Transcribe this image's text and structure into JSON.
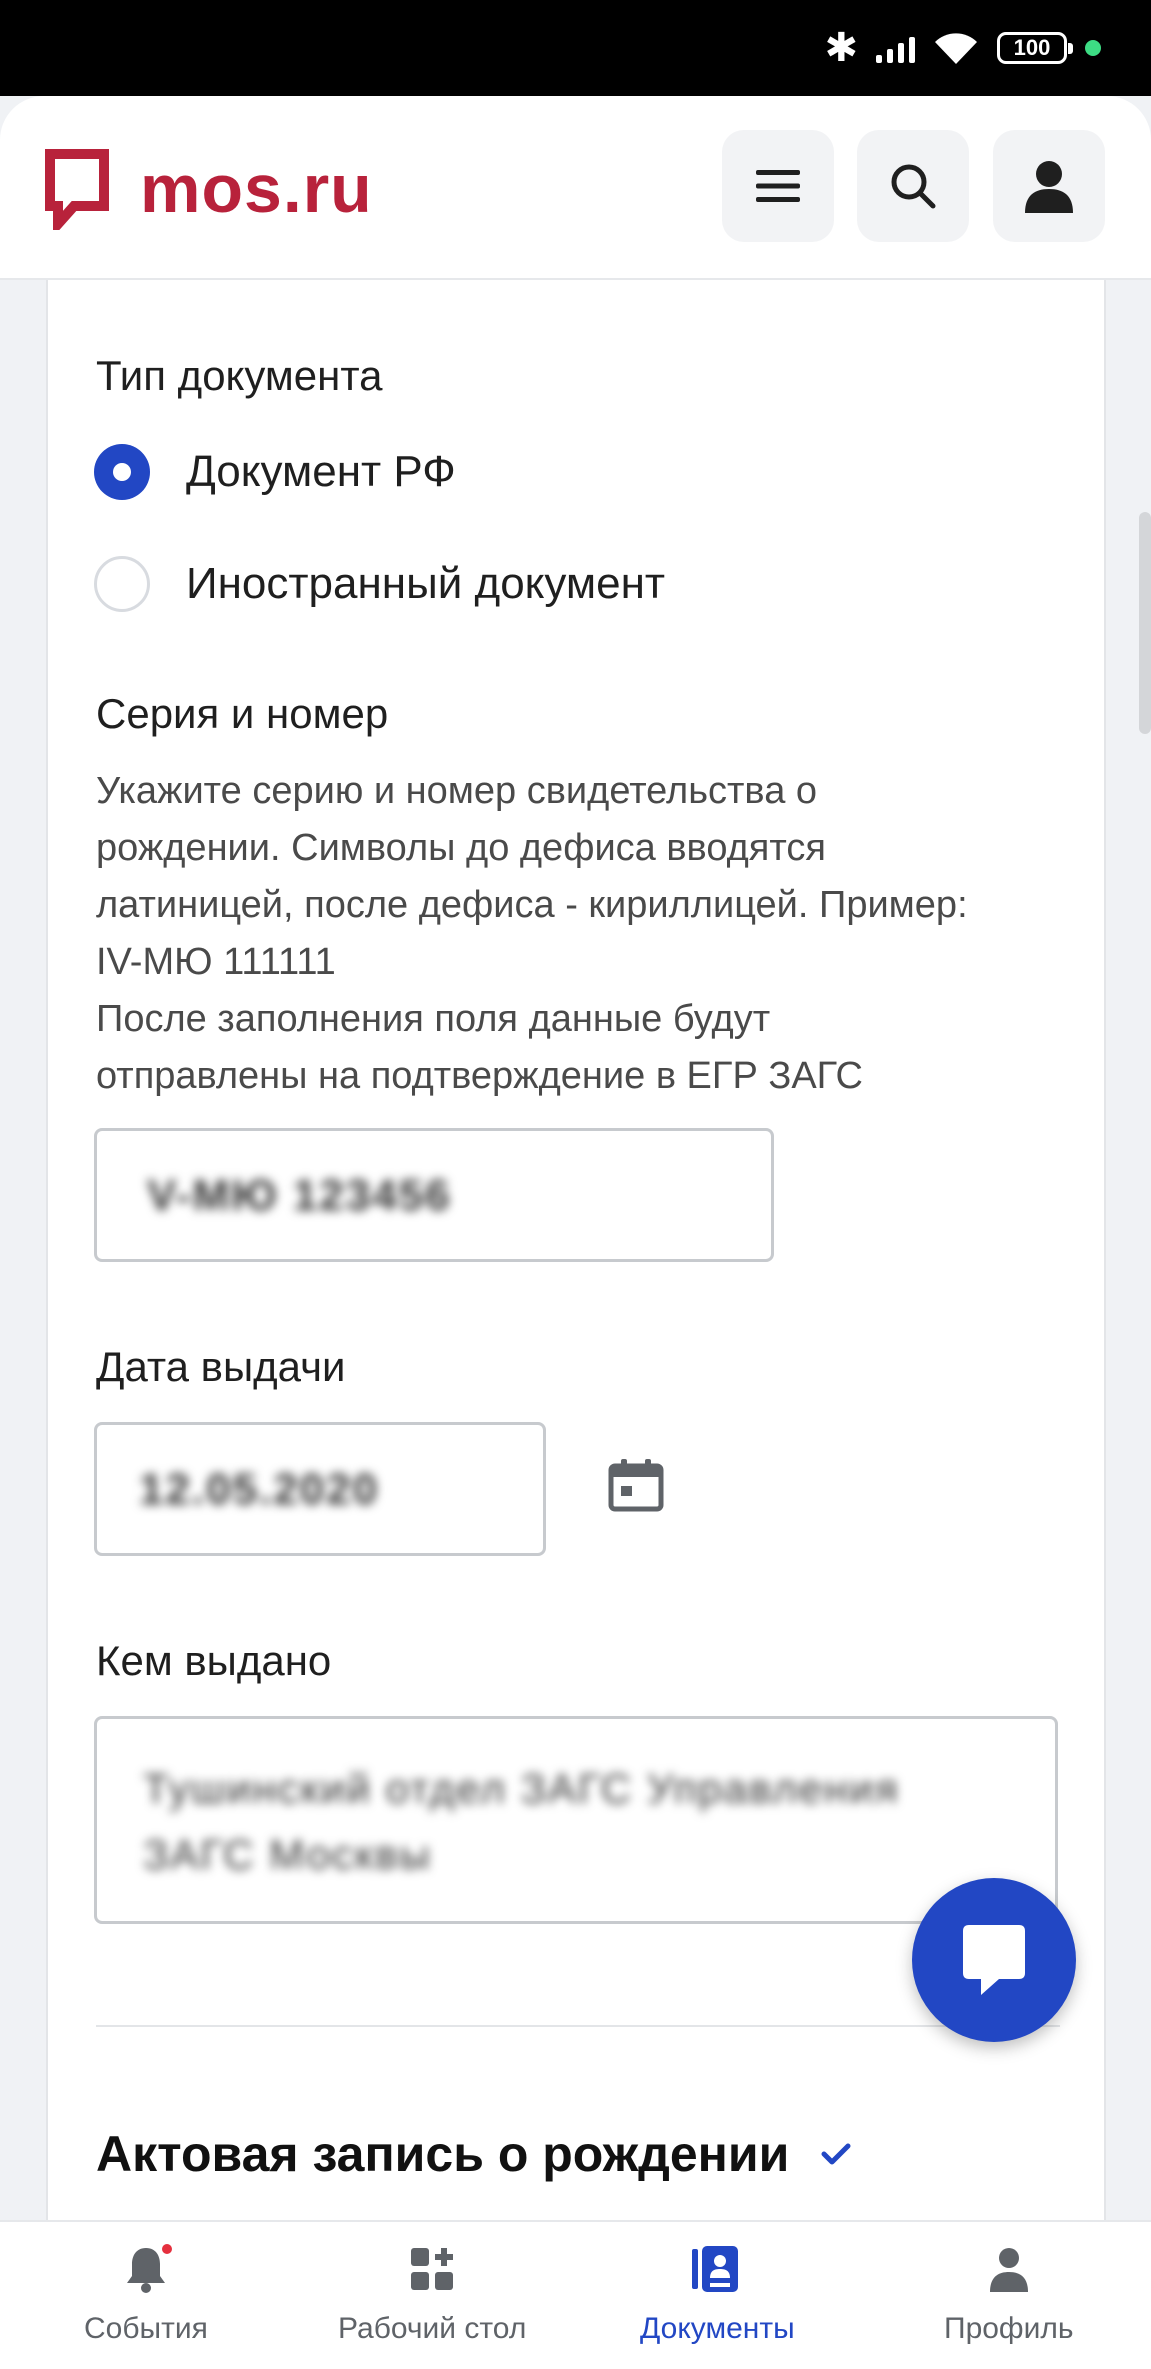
{
  "status_bar": {
    "battery": "100"
  },
  "header": {
    "logo_text": "mos.ru",
    "brand_color": "#b8223b",
    "menu_icon": "menu-icon",
    "search_icon": "search-icon",
    "profile_icon": "user-icon"
  },
  "form": {
    "doc_type": {
      "label": "Тип документа",
      "options": [
        "Документ РФ",
        "Иностранный документ"
      ],
      "selected": "Документ РФ"
    },
    "series_number": {
      "label": "Серия и номер",
      "hint_lines": [
        "Укажите серию и номер свидетельства о",
        "рождении. Символы до дефиса вводятся",
        "латиницей, после дефиса - кириллицей. Пример:",
        "IV-МЮ 111111",
        "После заполнения поля данные будут",
        "отправлены на подтверждение в ЕГР ЗАГС"
      ],
      "value_blurred": "V-МЮ 123456"
    },
    "issue_date": {
      "label": "Дата выдачи",
      "value_blurred": "12.05.2020",
      "calendar_icon": "calendar-icon"
    },
    "issued_by": {
      "label": "Кем выдано",
      "value_blurred_line1": "Тушинский отдел ЗАГС Управления",
      "value_blurred_line2": "ЗАГС Москвы"
    },
    "section_title": "Актовая запись о рождении",
    "accent_color": "#2247c4"
  },
  "bottom_nav": {
    "items": [
      {
        "label": "События",
        "icon": "bell-icon",
        "active": false
      },
      {
        "label": "Рабочий стол",
        "icon": "widgets-icon",
        "active": false
      },
      {
        "label": "Документы",
        "icon": "documents-icon",
        "active": true
      },
      {
        "label": "Профиль",
        "icon": "profile-icon",
        "active": false
      }
    ]
  }
}
